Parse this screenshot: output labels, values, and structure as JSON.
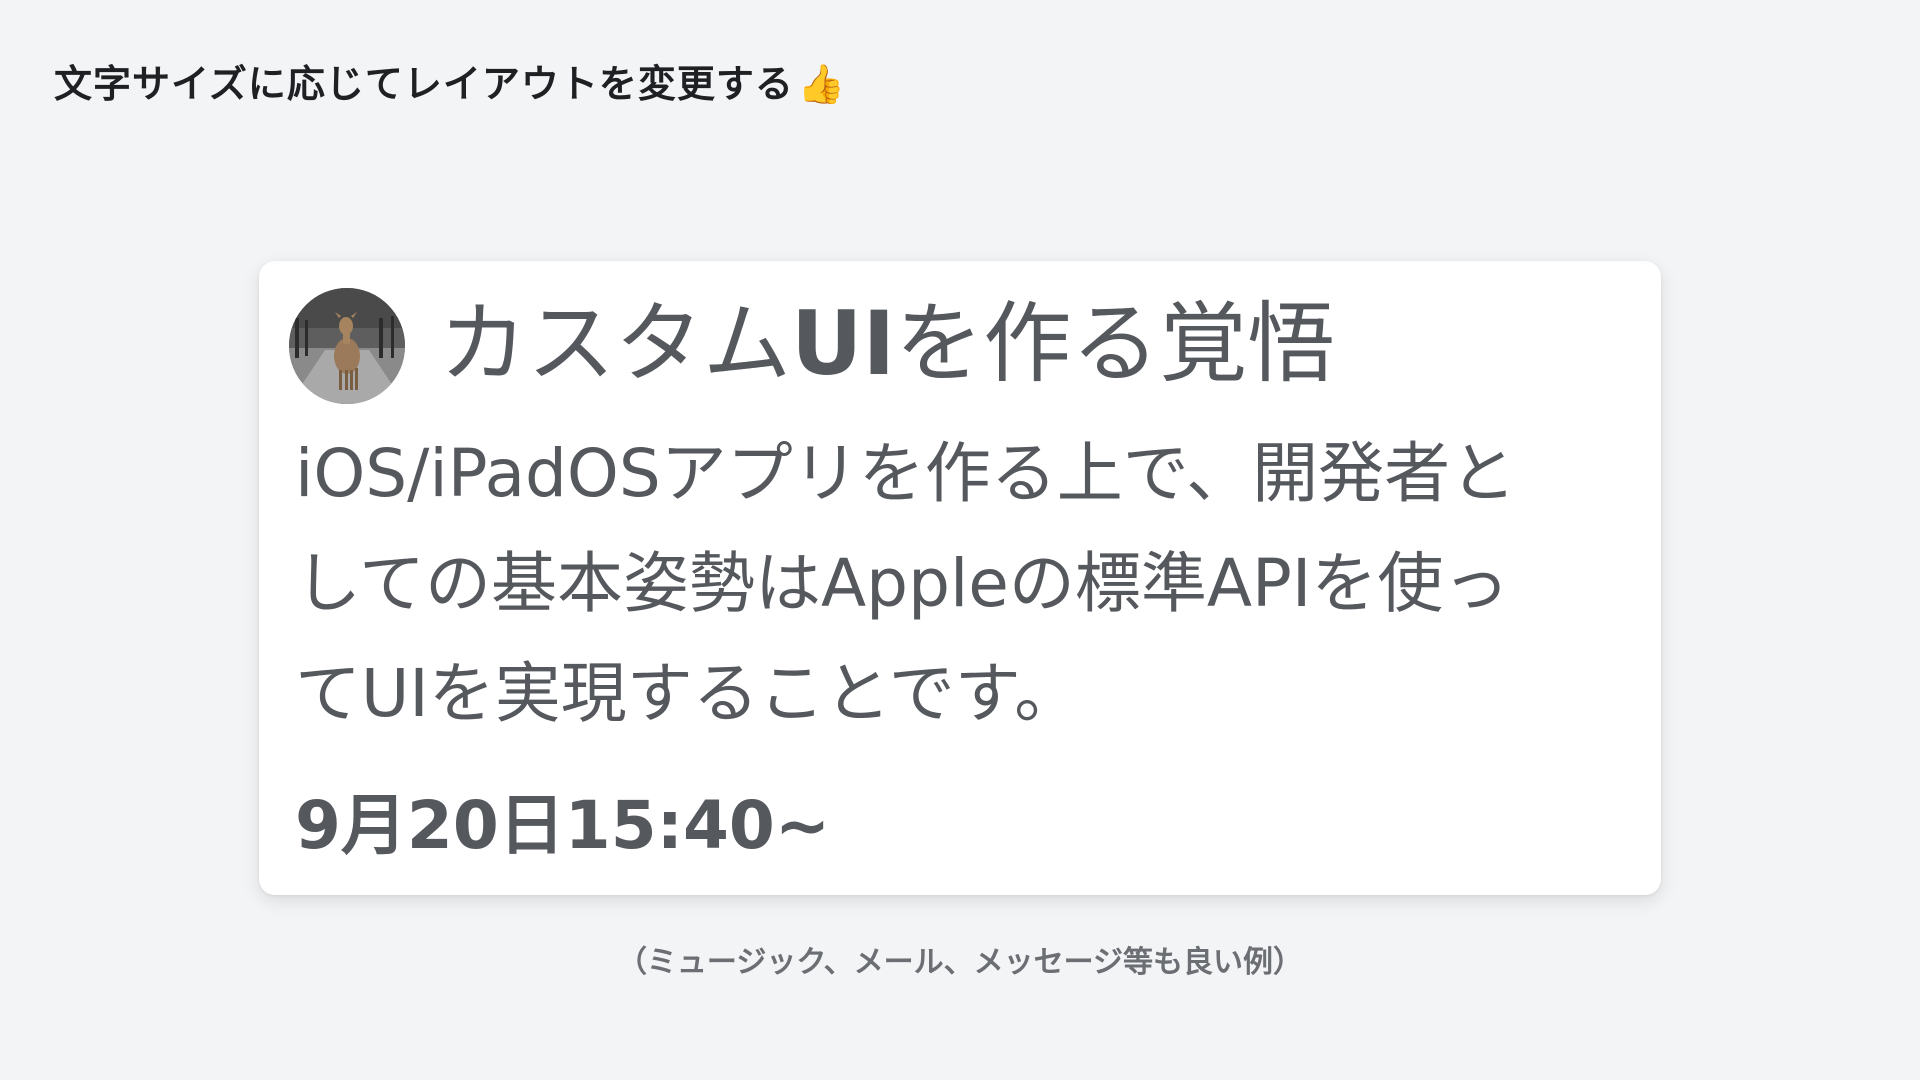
{
  "slide": {
    "title": "文字サイズに応じてレイアウトを変更する",
    "title_emoji": "👍",
    "title_emoji_icon": "thumbs-up-icon"
  },
  "card": {
    "avatar_icon": "deer-photo-avatar",
    "heading_part1": "カスタム",
    "heading_bold": "UI",
    "heading_part2": "を作る覚悟",
    "body_lines": [
      "iOS/iPadOSアプリを作る上で、開発者と",
      "しての基本姿勢はAppleの標準APIを使っ",
      "てUIを実現することです。"
    ],
    "date": "9月20日15:40~"
  },
  "caption": "（ミュージック、メール、メッセージ等も良い例）",
  "colors": {
    "background": "#f3f4f6",
    "card": "#ffffff",
    "card_text": "#55585d",
    "title_text": "#1f2023",
    "caption_text": "#6b6e73"
  }
}
